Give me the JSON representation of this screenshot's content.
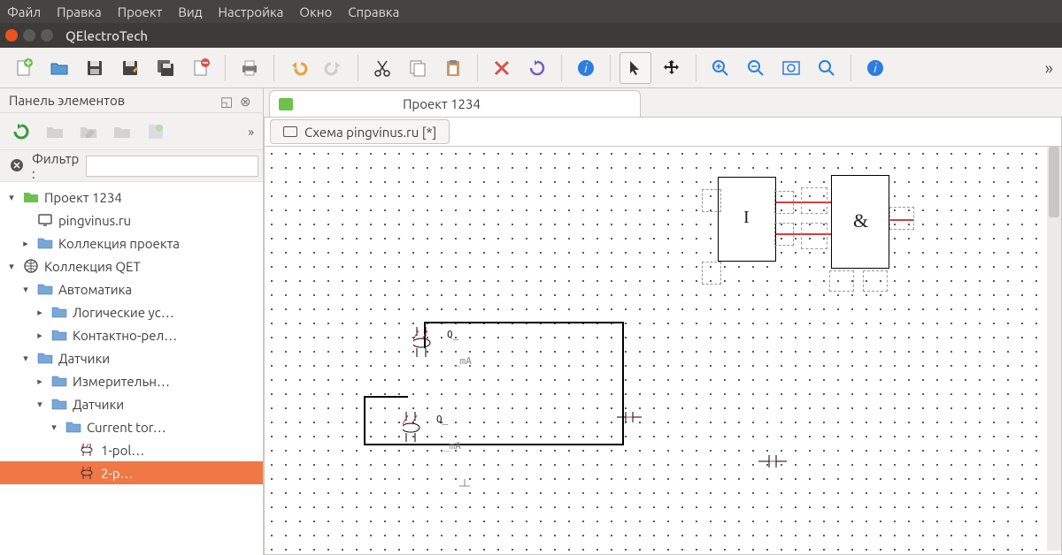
{
  "menu": [
    "Файл",
    "Правка",
    "Проект",
    "Вид",
    "Настройка",
    "Окно",
    "Справка"
  ],
  "window": {
    "title": "QElectroTech"
  },
  "toolbar": {
    "items": [
      "new",
      "open",
      "save",
      "save-as",
      "save-all",
      "close",
      "|",
      "print",
      "|",
      "undo",
      "redo",
      "|",
      "cut",
      "copy",
      "paste",
      "|",
      "delete",
      "rotate",
      "|",
      "info",
      "|",
      "pointer",
      "move",
      "|",
      "zoom-in",
      "zoom-out",
      "zoom-fit",
      "zoom-reset",
      "|",
      "about"
    ]
  },
  "panel": {
    "title": "Панель элементов",
    "filter_label": "Фильтр :",
    "filter_value": ""
  },
  "tree": [
    {
      "d": 1,
      "exp": "▾",
      "icon": "folder-green",
      "label": "Проект 1234"
    },
    {
      "d": 2,
      "exp": "",
      "icon": "monitor",
      "label": "pingvinus.ru"
    },
    {
      "d": 2,
      "exp": "▸",
      "icon": "folder",
      "label": "Коллекция проекта"
    },
    {
      "d": 1,
      "exp": "▾",
      "icon": "globe",
      "label": "Коллекция QET"
    },
    {
      "d": 2,
      "exp": "▾",
      "icon": "folder",
      "label": "Автоматика"
    },
    {
      "d": 3,
      "exp": "▸",
      "icon": "folder",
      "label": "Логические ус…"
    },
    {
      "d": 3,
      "exp": "▸",
      "icon": "folder",
      "label": "Контактно-рел…"
    },
    {
      "d": 2,
      "exp": "▾",
      "icon": "folder",
      "label": "Датчики"
    },
    {
      "d": 3,
      "exp": "▸",
      "icon": "folder",
      "label": "Измерительн…"
    },
    {
      "d": 3,
      "exp": "▾",
      "icon": "folder",
      "label": "Датчики"
    },
    {
      "d": 4,
      "exp": "▾",
      "icon": "folder",
      "label": "Current tor…"
    },
    {
      "d": 5,
      "exp": "",
      "icon": "element",
      "label": "1-pol…"
    },
    {
      "d": 5,
      "exp": "",
      "icon": "element",
      "label": "2-p…",
      "selected": true
    }
  ],
  "doc": {
    "tab": "Проект 1234",
    "sheet_tab": "Схема pingvinus.ru [*]"
  },
  "schematic": {
    "gate1": "I",
    "gate2": "&",
    "q_label": "Q_",
    "ma_label": "_mA"
  }
}
